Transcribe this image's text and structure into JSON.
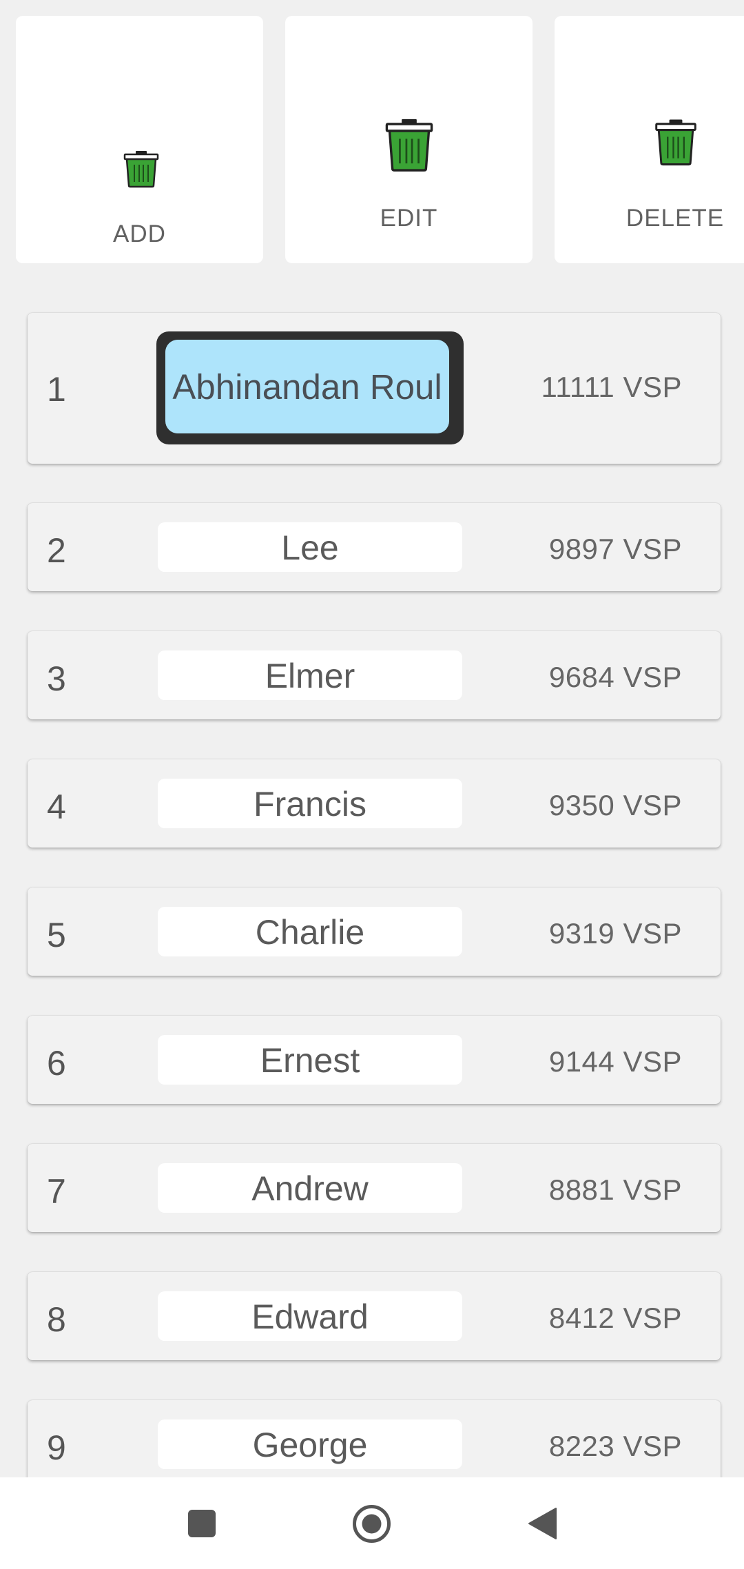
{
  "actions": [
    {
      "label": "ADD",
      "icon": "trash-bin-icon"
    },
    {
      "label": "EDIT",
      "icon": "trash-bin-icon"
    },
    {
      "label": "DELETE",
      "icon": "trash-bin-icon"
    }
  ],
  "leaderboard": [
    {
      "rank": "1",
      "name": "Abhinandan Roul",
      "score": "11111 VSP"
    },
    {
      "rank": "2",
      "name": "Lee",
      "score": "9897 VSP"
    },
    {
      "rank": "3",
      "name": "Elmer",
      "score": "9684 VSP"
    },
    {
      "rank": "4",
      "name": "Francis",
      "score": "9350 VSP"
    },
    {
      "rank": "5",
      "name": "Charlie",
      "score": "9319 VSP"
    },
    {
      "rank": "6",
      "name": "Ernest",
      "score": "9144 VSP"
    },
    {
      "rank": "7",
      "name": "Andrew",
      "score": "8881 VSP"
    },
    {
      "rank": "8",
      "name": "Edward",
      "score": "8412 VSP"
    },
    {
      "rank": "9",
      "name": "George",
      "score": "8223 VSP"
    }
  ],
  "navbar": {
    "buttons": [
      "recents-square-icon",
      "home-circle-icon",
      "back-triangle-icon"
    ]
  },
  "colors": {
    "background": "#f0f0f0",
    "highlight_fill": "#aee4fb",
    "highlight_border": "#2f2f2f",
    "bin_green": "#3aa335"
  }
}
